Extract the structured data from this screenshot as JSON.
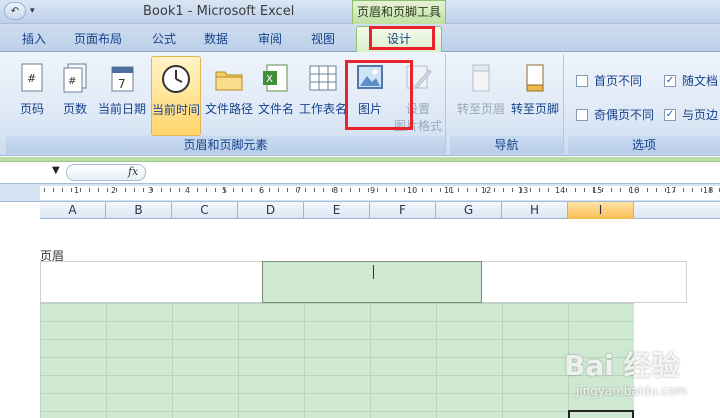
{
  "window": {
    "title": "Book1 - Microsoft Excel",
    "context_tab_group": "页眉和页脚工具"
  },
  "tabs": [
    "插入",
    "页面布局",
    "公式",
    "数据",
    "审阅",
    "视图"
  ],
  "active_tab": "设计",
  "ribbon": {
    "group1": {
      "label": "页眉和页脚元素",
      "buttons": [
        {
          "label": "页码",
          "icon": "page-number-icon"
        },
        {
          "label": "页数",
          "icon": "page-count-icon"
        },
        {
          "label": "当前日期",
          "icon": "calendar-icon"
        },
        {
          "label": "当前时间",
          "icon": "clock-icon"
        },
        {
          "label": "文件路径",
          "icon": "folder-icon"
        },
        {
          "label": "文件名",
          "icon": "excel-file-icon"
        },
        {
          "label": "工作表名",
          "icon": "sheet-icon"
        },
        {
          "label": "图片",
          "icon": "picture-icon"
        },
        {
          "label1": "设置",
          "label2": "图片格式",
          "icon": "format-picture-icon"
        }
      ]
    },
    "group2": {
      "label": "导航",
      "buttons": [
        {
          "label": "转至页眉",
          "icon": "goto-header-icon"
        },
        {
          "label": "转至页脚",
          "icon": "goto-footer-icon"
        }
      ]
    },
    "group3": {
      "label": "选项",
      "checkboxes": [
        {
          "label": "首页不同",
          "checked": false
        },
        {
          "label": "奇偶页不同",
          "checked": false
        },
        {
          "label": "随文档",
          "checked": true
        },
        {
          "label": "与页边",
          "checked": true
        }
      ]
    }
  },
  "formula_bar": {
    "fx": "fx"
  },
  "ruler": {
    "numbers": [
      "1",
      "2",
      "3",
      "4",
      "5",
      "6",
      "7",
      "8",
      "9",
      "10",
      "11",
      "12",
      "13",
      "14",
      "15",
      "16",
      "17",
      "18"
    ]
  },
  "columns": [
    "A",
    "B",
    "C",
    "D",
    "E",
    "F",
    "G",
    "H",
    "I"
  ],
  "selected_column": "I",
  "page": {
    "header_label": "页眉"
  },
  "watermark": {
    "brand": "Bai 经验",
    "url": "jingyan.baidu.com"
  }
}
